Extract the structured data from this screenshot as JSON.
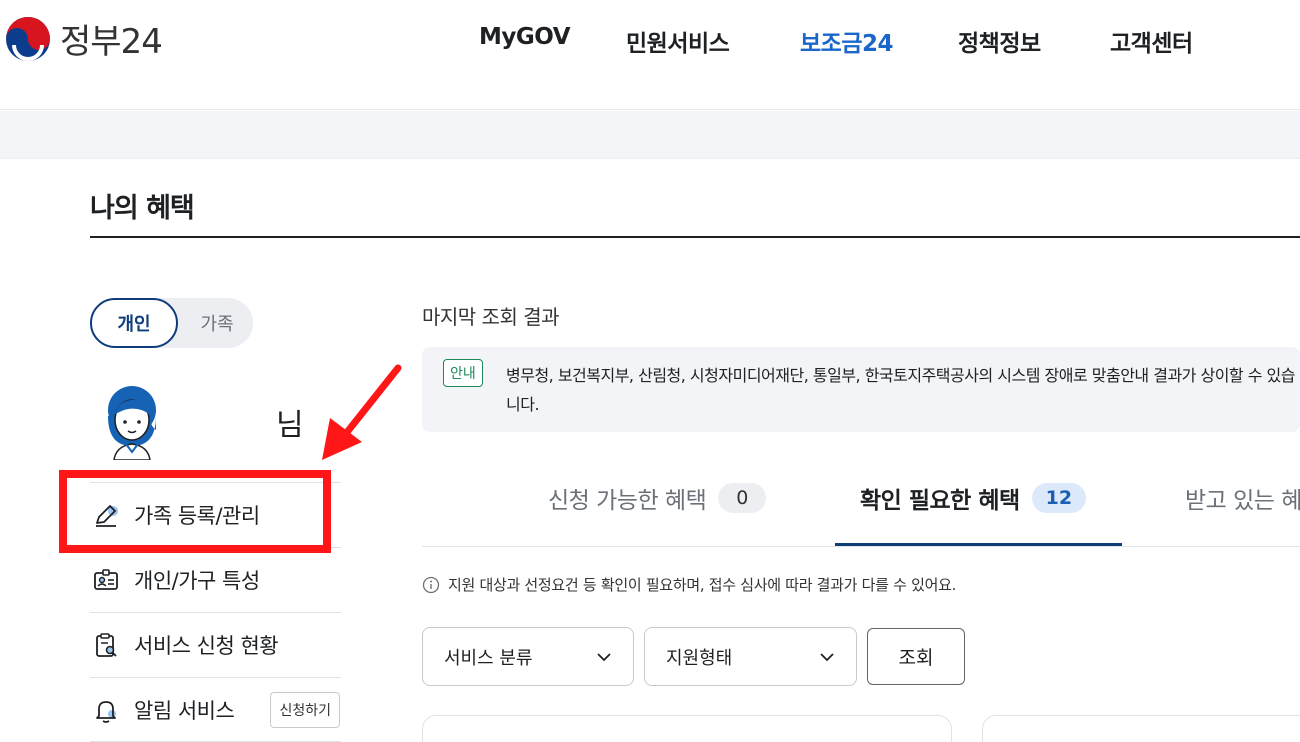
{
  "header": {
    "logo_text": "정부24",
    "nav": [
      {
        "label": "MyGOV",
        "active": false
      },
      {
        "label": "민원서비스",
        "active": false
      },
      {
        "label": "보조금24",
        "active": true
      },
      {
        "label": "정책정보",
        "active": false
      },
      {
        "label": "고객센터",
        "active": false
      }
    ]
  },
  "page": {
    "title": "나의 혜택"
  },
  "toggle": {
    "personal": "개인",
    "family": "가족",
    "selected": "개인"
  },
  "profile": {
    "name_suffix": "님"
  },
  "sidebar": {
    "items": [
      {
        "label": "가족 등록/관리",
        "icon": "pencil-icon"
      },
      {
        "label": "개인/가구 특성",
        "icon": "id-card-icon"
      },
      {
        "label": "서비스 신청 현황",
        "icon": "clipboard-search-icon"
      },
      {
        "label": "알림 서비스",
        "icon": "bell-icon",
        "button": "신청하기"
      }
    ]
  },
  "main": {
    "last_result_label": "마지막 조회 결과",
    "notice": {
      "badge": "안내",
      "text": "병무청, 보건복지부, 산림청, 시청자미디어재단, 통일부, 한국토지주택공사의 시스템 장애로 맞춤안내 결과가 상이할 수 있습니다."
    },
    "tabs": [
      {
        "label": "신청 가능한 혜택",
        "count": "0",
        "active": false
      },
      {
        "label": "확인 필요한 혜택",
        "count": "12",
        "active": true
      },
      {
        "label": "받고 있는 혜택",
        "count": "",
        "active": false
      }
    ],
    "info_text": "지원 대상과 선정요건 등 확인이 필요하며, 접수 심사에 따라 결과가 다를 수 있어요.",
    "filters": {
      "category": "서비스 분류",
      "support_type": "지원형태",
      "search_button": "조회"
    }
  },
  "colors": {
    "accent_blue": "#1a66c9",
    "navy": "#0f3d7a",
    "highlight_red": "#ff1616",
    "notice_green": "#1b8a5a"
  }
}
